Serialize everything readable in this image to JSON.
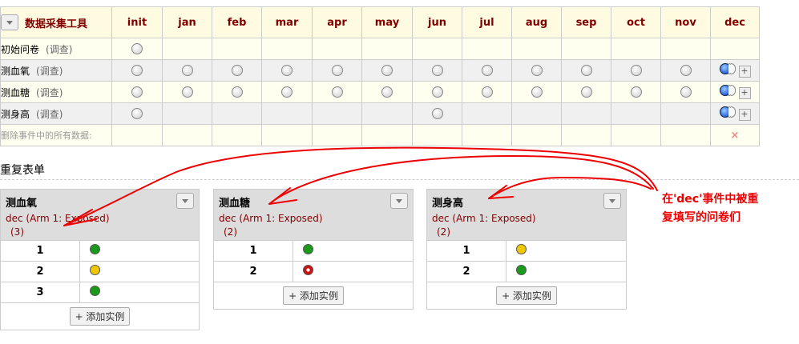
{
  "grid": {
    "corner_label": "数据采集工具",
    "events": [
      "init",
      "jan",
      "feb",
      "mar",
      "apr",
      "may",
      "jun",
      "jul",
      "aug",
      "sep",
      "oct",
      "nov",
      "dec"
    ],
    "rows": [
      {
        "label": "初始问卷",
        "sub": "(调查)"
      },
      {
        "label": "测血氧",
        "sub": "(调查)"
      },
      {
        "label": "测血糖",
        "sub": "(调查)"
      },
      {
        "label": "测身高",
        "sub": "(调查)"
      }
    ],
    "delete_row_label": "删除事件中的所有数据:",
    "delete_icon": "×",
    "add_symbol": "+"
  },
  "status_colors": {
    "green": "#1a9a1a",
    "yellow": "#f0c800",
    "red": "#d01010",
    "blue": "#0033cc",
    "gray": "#cccccc"
  },
  "section_title": "重复表单",
  "cards": [
    {
      "title": "测血氧",
      "event": "dec (Arm 1: Exposed)",
      "count": "(3)",
      "instances": [
        {
          "n": "1",
          "status": "green"
        },
        {
          "n": "2",
          "status": "yellow"
        },
        {
          "n": "3",
          "status": "green"
        }
      ],
      "add_button": "+ 添加实例"
    },
    {
      "title": "测血糖",
      "event": "dec (Arm 1: Exposed)",
      "count": "(2)",
      "instances": [
        {
          "n": "1",
          "status": "green"
        },
        {
          "n": "2",
          "status": "red"
        }
      ],
      "add_button": "+ 添加实例"
    },
    {
      "title": "测身高",
      "event": "dec (Arm 1: Exposed)",
      "count": "(2)",
      "instances": [
        {
          "n": "1",
          "status": "yellow"
        },
        {
          "n": "2",
          "status": "green"
        }
      ],
      "add_button": "+ 添加实例"
    }
  ],
  "annotation": {
    "line1": "在'dec'事件中被重",
    "line2": "复填写的问卷们",
    "color": "#ee0000"
  }
}
